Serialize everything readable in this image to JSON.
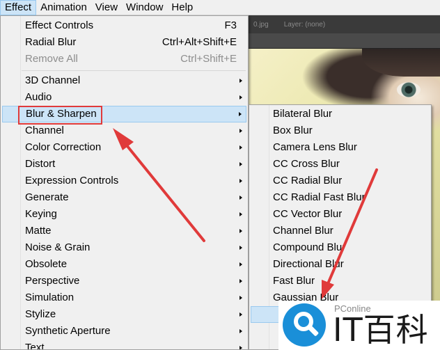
{
  "menubar": {
    "items": [
      "Effect",
      "Animation",
      "View",
      "Window",
      "Help"
    ]
  },
  "app": {
    "file_tab": "0.jpg",
    "layer_label": "Layer: (none)"
  },
  "menu": {
    "items": [
      {
        "label": "Effect Controls",
        "shortcut": "F3"
      },
      {
        "label": "Radial Blur",
        "shortcut": "Ctrl+Alt+Shift+E"
      },
      {
        "label": "Remove All",
        "shortcut": "Ctrl+Shift+E"
      },
      {
        "label": "3D Channel"
      },
      {
        "label": "Audio"
      },
      {
        "label": "Blur & Sharpen"
      },
      {
        "label": "Channel"
      },
      {
        "label": "Color Correction"
      },
      {
        "label": "Distort"
      },
      {
        "label": "Expression Controls"
      },
      {
        "label": "Generate"
      },
      {
        "label": "Keying"
      },
      {
        "label": "Matte"
      },
      {
        "label": "Noise & Grain"
      },
      {
        "label": "Obsolete"
      },
      {
        "label": "Perspective"
      },
      {
        "label": "Simulation"
      },
      {
        "label": "Stylize"
      },
      {
        "label": "Synthetic Aperture"
      },
      {
        "label": "Text"
      }
    ]
  },
  "submenu": {
    "items": [
      "Bilateral Blur",
      "Box Blur",
      "Camera Lens Blur",
      "CC Cross Blur",
      "CC Radial Blur",
      "CC Radial Fast Blur",
      "CC Vector Blur",
      "Channel Blur",
      "Compound Blur",
      "Directional Blur",
      "Fast Blur",
      "Gaussian Blur"
    ]
  },
  "watermark": {
    "small": "PConline",
    "big": "IT百科"
  },
  "colors": {
    "menu_bg": "#f0f0f0",
    "highlight_bg": "#cce4f7",
    "highlight_border": "#99c9ef",
    "annotation_red": "#e03a3a",
    "disabled_text": "#8d8d8d",
    "watermark_blue": "#1a8fd8"
  }
}
